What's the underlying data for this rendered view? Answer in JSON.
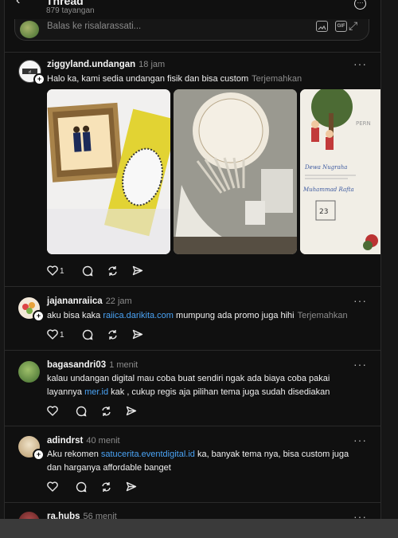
{
  "header": {
    "back_glyph": "‹",
    "title": "Thread",
    "subtitle": "879 tayangan",
    "more_glyph": "···"
  },
  "reply": {
    "placeholder": "Balas ke risalarassati...",
    "gif_label": "GIF"
  },
  "posts": [
    {
      "username": "ziggyland.undangan",
      "time": "18 jam",
      "text": "Halo ka, kami sedia undangan fisik dan bisa custom",
      "translate": "Terjemahkan",
      "likes": "1",
      "avatar_color": "#f2f2f2"
    },
    {
      "username": "jajananraiica",
      "time": "22 jam",
      "text_before": "aku bisa kaka",
      "link": "raiica.darikita.com",
      "text_after": "mumpung ada promo juga hihi",
      "translate": "Terjemahkan",
      "likes": "1",
      "avatar_color": "#f4e9d9"
    },
    {
      "username": "bagasandri03",
      "time": "1 menit",
      "text_before": "kalau undangan digital mau coba buat sendiri ngak ada biaya coba pakai layannya",
      "link": "mer.id",
      "text_after": "kak , cukup regis aja pilihan tema juga sudah disediakan",
      "avatar_color": "#5f8b3e"
    },
    {
      "username": "adindrst",
      "time": "40 menit",
      "text_before": "Aku rekomen",
      "link": "satucerita.eventdigital.id",
      "text_after": "ka, banyak tema nya, bisa custom juga dan harganya affordable banget",
      "avatar_color": "#d9c7a8"
    },
    {
      "username": "ra.hubs",
      "time": "56 menit",
      "avatar_color": "#7a2a2a"
    }
  ],
  "invitation": {
    "name1": "Dewa Nugraha",
    "name2": "Muhammad Rafta",
    "date": "23"
  },
  "colors": {
    "background": "#101010",
    "link": "#4aa3f5",
    "muted": "#8c8c8c"
  }
}
